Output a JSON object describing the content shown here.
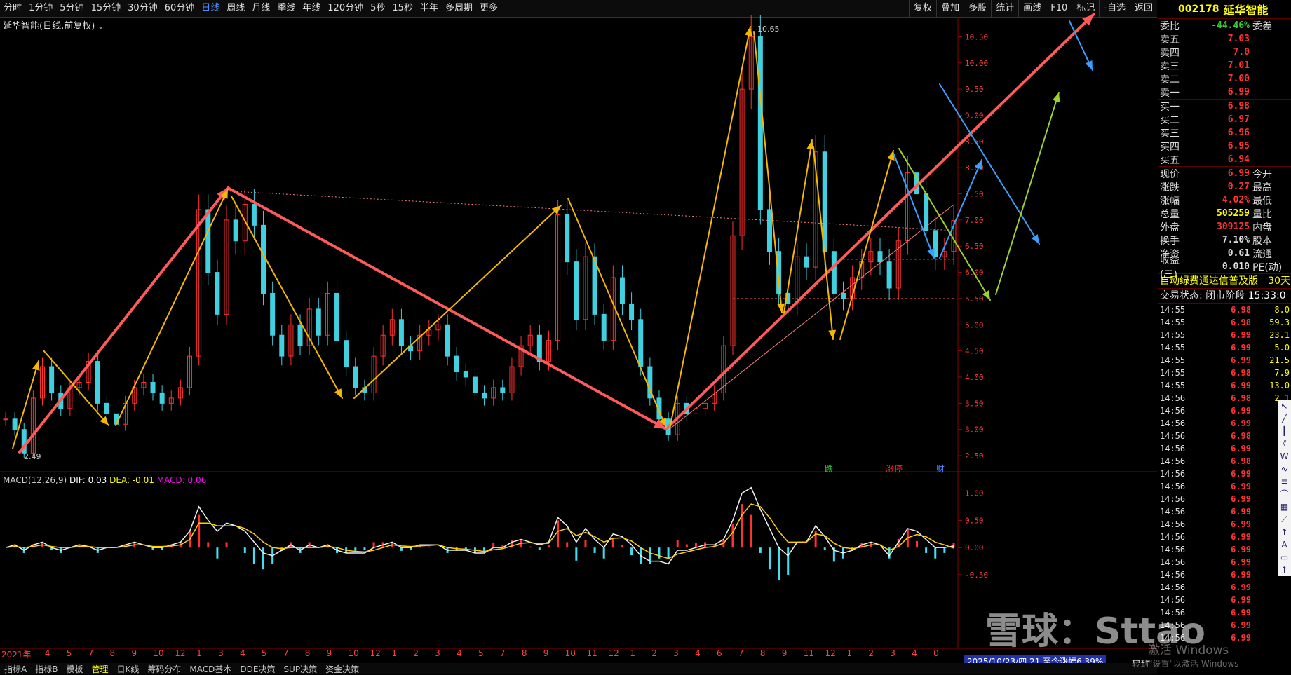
{
  "toolbar": {
    "periods": [
      "分时",
      "1分钟",
      "5分钟",
      "15分钟",
      "30分钟",
      "60分钟",
      "日线",
      "周线",
      "月线",
      "季线",
      "年线",
      "120分钟",
      "5秒",
      "15秒",
      "半年",
      "多周期",
      "更多"
    ],
    "active_index": 6,
    "tools": [
      "复权",
      "叠加",
      "多股",
      "统计",
      "画线",
      "F10",
      "标记",
      "-自选",
      "返回"
    ]
  },
  "chart_title": "延华智能(日线,前复权)",
  "stock": {
    "code": "002178",
    "name": "延华智能"
  },
  "order_book": {
    "weibi_label": "委比",
    "weibi_value": "-44.46%",
    "weicha_label": "委差",
    "sells": [
      {
        "label": "卖五",
        "price": "7.03"
      },
      {
        "label": "卖四",
        "price": "7.0"
      },
      {
        "label": "卖三",
        "price": "7.01"
      },
      {
        "label": "卖二",
        "price": "7.00"
      },
      {
        "label": "卖一",
        "price": "6.99"
      }
    ],
    "buys": [
      {
        "label": "买一",
        "price": "6.98"
      },
      {
        "label": "买二",
        "price": "6.97"
      },
      {
        "label": "买三",
        "price": "6.96"
      },
      {
        "label": "买四",
        "price": "6.95"
      },
      {
        "label": "买五",
        "price": "6.94"
      }
    ]
  },
  "quote": [
    {
      "label": "现价",
      "value": "6.99",
      "label2": "今开"
    },
    {
      "label": "涨跌",
      "value": "0.27",
      "label2": "最高"
    },
    {
      "label": "涨幅",
      "value": "4.02%",
      "label2": "最低"
    },
    {
      "label": "总量",
      "value": "505259",
      "label2": "量比"
    },
    {
      "label": "外盘",
      "value": "309125",
      "label2": "内盘"
    },
    {
      "label": "换手",
      "value": "7.10%",
      "label2": "股本"
    },
    {
      "label": "净资",
      "value": "0.61",
      "label2": "流通"
    },
    {
      "label": "收益(三)",
      "value": "0.010",
      "label2": "PE(动)"
    }
  ],
  "marquee": "自动绿费通达信普及版",
  "marquee_right": "30天",
  "status": {
    "label": "交易状态: 闭市阶段",
    "time": "15:33:0"
  },
  "ticks": [
    {
      "t": "14:55",
      "p": "6.98",
      "v": "8.0"
    },
    {
      "t": "14:55",
      "p": "6.98",
      "v": "59.3"
    },
    {
      "t": "14:55",
      "p": "6.99",
      "v": "23.1"
    },
    {
      "t": "14:55",
      "p": "6.99",
      "v": "5.0"
    },
    {
      "t": "14:55",
      "p": "6.99",
      "v": "21.5"
    },
    {
      "t": "14:55",
      "p": "6.98",
      "v": "7.9"
    },
    {
      "t": "14:55",
      "p": "6.99",
      "v": "13.0"
    },
    {
      "t": "14:56",
      "p": "6.98",
      "v": "2.1"
    },
    {
      "t": "14:56",
      "p": "6.99",
      "v": ""
    },
    {
      "t": "14:56",
      "p": "6.99",
      "v": ""
    },
    {
      "t": "14:56",
      "p": "6.98",
      "v": ""
    },
    {
      "t": "14:56",
      "p": "6.99",
      "v": ""
    },
    {
      "t": "14:56",
      "p": "6.98",
      "v": ""
    },
    {
      "t": "14:56",
      "p": "6.99",
      "v": ""
    },
    {
      "t": "14:56",
      "p": "6.99",
      "v": ""
    },
    {
      "t": "14:56",
      "p": "6.99",
      "v": ""
    },
    {
      "t": "14:56",
      "p": "6.99",
      "v": ""
    },
    {
      "t": "14:56",
      "p": "6.99",
      "v": ""
    },
    {
      "t": "14:56",
      "p": "6.99",
      "v": ""
    },
    {
      "t": "14:56",
      "p": "6.99",
      "v": ""
    },
    {
      "t": "14:56",
      "p": "6.99",
      "v": ""
    },
    {
      "t": "14:56",
      "p": "6.99",
      "v": ""
    },
    {
      "t": "14:56",
      "p": "6.99",
      "v": ""
    },
    {
      "t": "14:56",
      "p": "6.99",
      "v": ""
    },
    {
      "t": "14:56",
      "p": "6.99",
      "v": ""
    },
    {
      "t": "14:56",
      "p": "6.99",
      "v": ""
    },
    {
      "t": "14:56",
      "p": "6.99",
      "v": ""
    }
  ],
  "price_axis": [
    "10.50",
    "10.00",
    "9.50",
    "9.00",
    "8.50",
    "8.00",
    "7.50",
    "7.00",
    "6.50",
    "6.00",
    "5.50",
    "5.00",
    "4.50",
    "4.00",
    "3.50",
    "3.00",
    "2.50"
  ],
  "annotations": {
    "high": "10.65",
    "low": "2.49"
  },
  "event_markers": [
    "跌",
    "涨停",
    "财"
  ],
  "macd": {
    "label": "MACD(12,26,9)",
    "dif": "DIF: 0.03",
    "dea": "DEA: -0.01",
    "macd": "MACD: 0.06",
    "axis": [
      "1.00",
      "0.50",
      "0.00",
      "-0.50"
    ]
  },
  "x_axis": [
    "2021年",
    "3",
    "4",
    "5",
    "7",
    "8",
    "9",
    "10",
    "12",
    "1",
    "3",
    "4",
    "5",
    "7",
    "8",
    "9",
    "10",
    "12",
    "1",
    "2",
    "3",
    "4",
    "5",
    "7",
    "8",
    "9",
    "10",
    "11",
    "12",
    "1",
    "2",
    "3",
    "4",
    "6",
    "7",
    "8",
    "9",
    "11",
    "12",
    "1",
    "2",
    "3",
    "4",
    "0"
  ],
  "date_tip": "2025/10/23/四 21 至今涨幅6.39%",
  "period_label": "日线",
  "bottom_tabs": [
    "指标A",
    "指标B",
    "模板",
    "管理",
    "日K线",
    "筹码分布",
    "MACD基本",
    "DDE决策",
    "SUP决策",
    "资金决策"
  ],
  "watermark": "雪球：Sttao",
  "activate": "激活 Windows",
  "activate2": "转到\"设置\"以激活 Windows",
  "drawing_tools": [
    "cursor-icon",
    "line-icon",
    "vertical-line-icon",
    "parallel-line-icon",
    "wave-icon",
    "fib-icon",
    "channel-icon",
    "arc-icon",
    "grid-icon",
    "fan-icon",
    "arrow-icon",
    "text-icon",
    "box-icon",
    "up-arrow-icon"
  ],
  "chart_data": {
    "type": "line",
    "title": "延华智能(日线,前复权)",
    "xlabel": "",
    "ylabel": "",
    "ylim": [
      2.3,
      10.8
    ],
    "series": [
      {
        "values": [
          3.2,
          3.0,
          2.55,
          3.6,
          4.2,
          3.7,
          3.4,
          3.8,
          3.9,
          4.3,
          3.5,
          3.3,
          3.1,
          3.5,
          3.8,
          3.9,
          3.7,
          3.5,
          3.6,
          3.8,
          4.4,
          7.2,
          6.0,
          5.2,
          7.0,
          6.6,
          7.3,
          6.9,
          5.6,
          4.8,
          4.4,
          5.0,
          4.6,
          5.3,
          4.8,
          5.6,
          4.7,
          4.2,
          3.8,
          3.7,
          4.4,
          4.8,
          5.1,
          4.6,
          4.5,
          4.8,
          4.9,
          5.0,
          4.4,
          4.1,
          4.0,
          3.7,
          3.6,
          3.8,
          3.7,
          4.2,
          4.6,
          4.8,
          4.3,
          4.7,
          7.1,
          6.2,
          5.1,
          6.3,
          5.2,
          4.7,
          5.9,
          5.4,
          5.1,
          4.2,
          3.6,
          3.2,
          2.9,
          3.5,
          3.3,
          3.4,
          3.5,
          3.7,
          4.6,
          6.7,
          9.5,
          10.5,
          7.2,
          6.4,
          5.6,
          5.4,
          6.3,
          6.1,
          8.3,
          6.4,
          5.6,
          5.5,
          5.9,
          6.2,
          6.4,
          6.2,
          5.7,
          6.6,
          7.9,
          7.5,
          6.8,
          6.3,
          6.4,
          6.99
        ]
      }
    ],
    "price_axis_range": [
      2.49,
      10.65
    ],
    "macd_axis_range": [
      -0.5,
      1.2
    ],
    "macd": {
      "dif": [
        0.0,
        0.05,
        -0.05,
        0.05,
        0.1,
        0.0,
        -0.05,
        0.0,
        0.05,
        0.02,
        -0.05,
        0.0,
        0.0,
        0.05,
        0.1,
        0.05,
        0.0,
        0.0,
        0.05,
        0.1,
        0.3,
        0.75,
        0.5,
        0.3,
        0.45,
        0.4,
        0.3,
        0.1,
        -0.1,
        -0.15,
        -0.05,
        0.05,
        -0.05,
        0.05,
        0.0,
        0.05,
        -0.05,
        -0.1,
        -0.1,
        -0.1,
        0.0,
        0.05,
        0.1,
        0.0,
        0.0,
        0.05,
        0.05,
        0.05,
        -0.05,
        -0.05,
        -0.05,
        -0.1,
        -0.1,
        0.0,
        0.0,
        0.1,
        0.15,
        0.1,
        0.05,
        0.1,
        0.55,
        0.4,
        0.1,
        0.35,
        0.15,
        0.0,
        0.25,
        0.2,
        0.05,
        -0.15,
        -0.25,
        -0.25,
        -0.3,
        -0.05,
        -0.05,
        0.0,
        0.05,
        0.05,
        0.15,
        0.5,
        1.0,
        1.1,
        0.7,
        0.35,
        0.0,
        -0.15,
        0.1,
        0.1,
        0.4,
        0.2,
        -0.05,
        -0.1,
        -0.05,
        0.05,
        0.1,
        0.05,
        -0.15,
        0.1,
        0.35,
        0.3,
        0.15,
        0.0,
        0.0,
        0.03
      ],
      "dea": [
        0.0,
        0.02,
        0.0,
        0.02,
        0.05,
        0.02,
        0.0,
        0.0,
        0.02,
        0.02,
        0.0,
        0.0,
        0.0,
        0.02,
        0.05,
        0.05,
        0.02,
        0.02,
        0.03,
        0.05,
        0.15,
        0.45,
        0.45,
        0.4,
        0.4,
        0.4,
        0.35,
        0.25,
        0.1,
        0.0,
        -0.02,
        0.0,
        0.0,
        0.0,
        0.0,
        0.02,
        0.0,
        -0.05,
        -0.07,
        -0.08,
        -0.05,
        0.0,
        0.05,
        0.03,
        0.02,
        0.03,
        0.04,
        0.05,
        0.0,
        -0.02,
        -0.03,
        -0.05,
        -0.07,
        -0.04,
        -0.02,
        0.03,
        0.08,
        0.09,
        0.07,
        0.08,
        0.3,
        0.35,
        0.22,
        0.28,
        0.2,
        0.1,
        0.17,
        0.18,
        0.12,
        0.0,
        -0.1,
        -0.15,
        -0.2,
        -0.12,
        -0.08,
        -0.04,
        0.0,
        0.02,
        0.08,
        0.28,
        0.6,
        0.8,
        0.75,
        0.55,
        0.3,
        0.1,
        0.1,
        0.1,
        0.25,
        0.22,
        0.08,
        0.0,
        -0.02,
        0.01,
        0.05,
        0.05,
        -0.05,
        0.02,
        0.18,
        0.24,
        0.2,
        0.1,
        0.05,
        -0.01
      ]
    }
  }
}
